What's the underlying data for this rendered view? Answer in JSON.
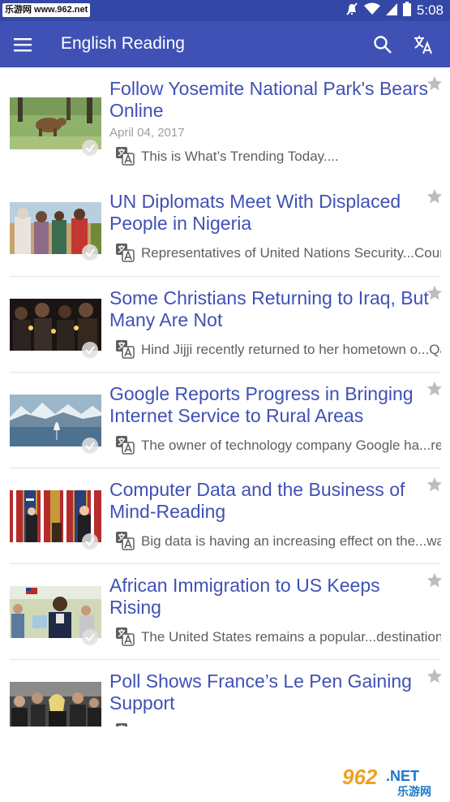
{
  "status_bar": {
    "watermark_text": "乐游网 www.962.net",
    "time": "5:08",
    "icons": [
      "mute-icon",
      "wifi-icon",
      "cell-signal-icon",
      "battery-icon"
    ]
  },
  "app_bar": {
    "title": "English Reading",
    "icons": [
      "menu-icon",
      "search-icon",
      "translate-icon"
    ],
    "color": "#3f51b5"
  },
  "articles": [
    {
      "title": "Follow Yosemite National Park's Bears Online",
      "date": "April 04, 2017",
      "summary": "This is What’s Trending Today....",
      "thumbnail": "bear-in-meadow"
    },
    {
      "title": "UN Diplomats Meet With Displaced People in Nigeria",
      "date": "",
      "summary": "Representatives of United Nations Security...Council",
      "thumbnail": "diplomats-with-displaced-people"
    },
    {
      "title": "Some Christians Returning to Iraq, But Many Are Not",
      "date": "",
      "summary": "Hind Jijji recently returned to her hometown o...Qaraqosh",
      "thumbnail": "candle-vigil"
    },
    {
      "title": "Google Reports Progress in Bringing Internet Service to Rural Areas",
      "date": "",
      "summary": "The owner of technology company Google ha...reported",
      "thumbnail": "balloon-over-mountains"
    },
    {
      "title": "Computer Data and the Business of Mind-Reading",
      "date": "",
      "summary": "Big data is having an increasing effect on the...way",
      "thumbnail": "press-conference-flags"
    },
    {
      "title": "African Immigration to US Keeps Rising",
      "date": "",
      "summary": "The United States remains a popular...destination",
      "thumbnail": "man-with-selfie"
    },
    {
      "title": "Poll Shows France’s Le Pen Gaining Support",
      "date": "",
      "summary": "",
      "thumbnail": "crowd-le-pen"
    }
  ],
  "watermark": {
    "text_top": "962.NET",
    "text_bottom": "乐游网"
  },
  "colors": {
    "accent": "#3f51b5",
    "status_bar": "#3347a6",
    "title_text": "#3f51b5",
    "summary_text": "#5f5f5f",
    "date_text": "#9e9e9e"
  }
}
